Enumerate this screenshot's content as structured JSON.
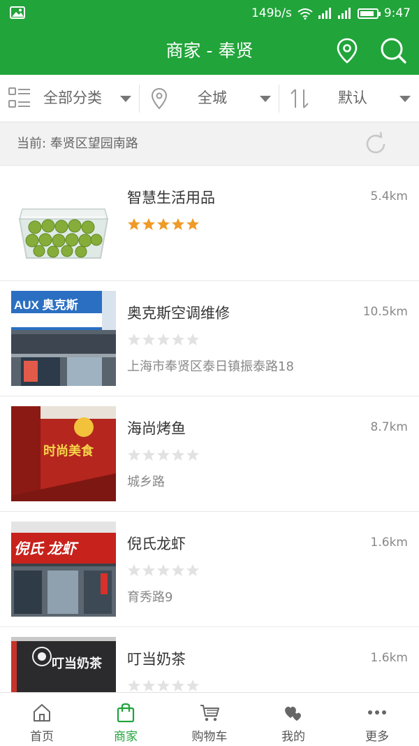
{
  "status_bar": {
    "net_speed": "149b/s",
    "time": "9:47",
    "icons": [
      "image-icon",
      "wifi-icon",
      "signal-icon",
      "signal-icon",
      "battery-icon"
    ],
    "battery_level": 0.85
  },
  "header": {
    "title": "商家 - 奉贤",
    "icons": [
      "location-pin-icon",
      "search-icon"
    ]
  },
  "filters": {
    "category": {
      "label": "全部分类",
      "icon": "grid-list-icon"
    },
    "area": {
      "label": "全城",
      "icon": "location-pin-icon"
    },
    "sort": {
      "label": "默认",
      "icon": "sort-icon"
    }
  },
  "location": {
    "text": "当前: 奉贤区望园南路",
    "icon": "refresh-icon"
  },
  "shops": [
    {
      "name": "智慧生活用品",
      "distance": "5.4km",
      "rating": 5,
      "address": "",
      "image": "green-fruit-box"
    },
    {
      "name": "奥克斯空调维修",
      "distance": "10.5km",
      "rating": 0,
      "address": "上海市奉贤区泰日镇振泰路18",
      "image": "aux-storefront",
      "sign_text": "AUX 奥克斯"
    },
    {
      "name": "海尚烤鱼",
      "distance": "8.7km",
      "rating": 0,
      "address": "城乡路",
      "image": "red-restaurant-sign",
      "sign_text": "时尚美食"
    },
    {
      "name": "倪氏龙虾",
      "distance": "1.6km",
      "rating": 0,
      "address": "育秀路9",
      "image": "lobster-storefront",
      "sign_text": "倪氏 龙虾"
    },
    {
      "name": "叮当奶茶",
      "distance": "1.6km",
      "rating": 0,
      "address": "",
      "image": "milk-tea-sign",
      "sign_text": "叮当奶茶"
    }
  ],
  "tabs": [
    {
      "label": "首页",
      "icon": "home-icon",
      "active": false
    },
    {
      "label": "商家",
      "icon": "shopping-bag-icon",
      "active": true
    },
    {
      "label": "购物车",
      "icon": "cart-icon",
      "active": false
    },
    {
      "label": "我的",
      "icon": "hearts-icon",
      "active": false
    },
    {
      "label": "更多",
      "icon": "more-dots-icon",
      "active": false
    }
  ],
  "colors": {
    "brand_green": "#21a43a",
    "star_filled": "#f09a28",
    "star_empty": "#e2e2e2"
  }
}
